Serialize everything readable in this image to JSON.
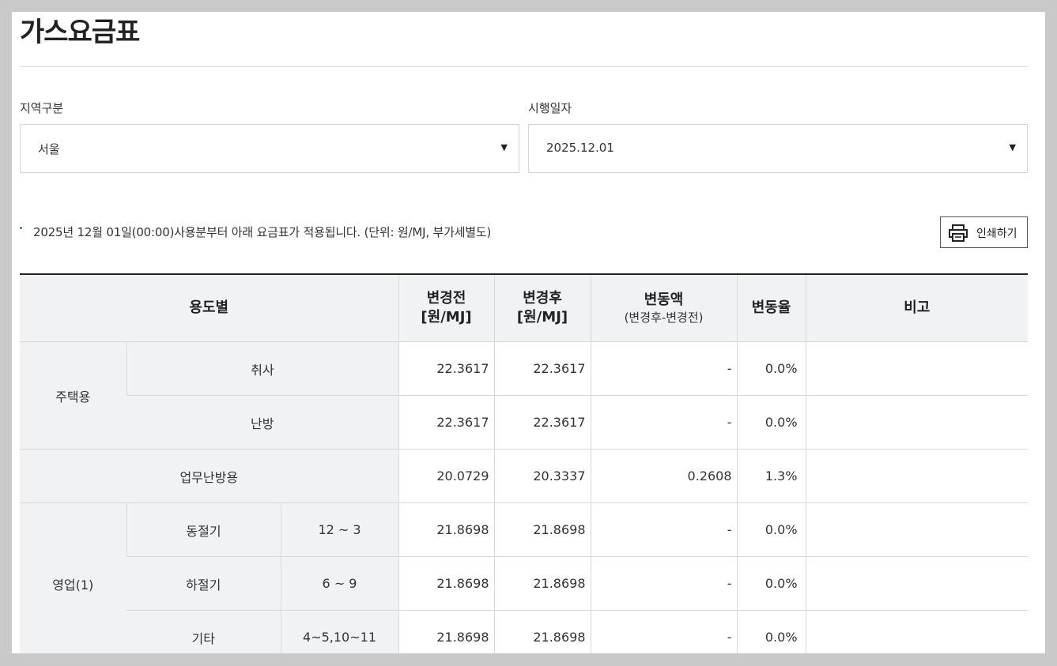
{
  "page": {
    "title": "가스요금표"
  },
  "filters": {
    "region_label": "지역구분",
    "region_value": "서울",
    "date_label": "시행일자",
    "date_value": "2025.12.01"
  },
  "notice": "2025년 12월 01일(00:00)사용분부터 아래 요금표가 적용됩니다. (단위: 원/MJ, 부가세별도)",
  "print_button": {
    "label": "인쇄하기",
    "icon": "printer-icon"
  },
  "table": {
    "headers": {
      "usage": "용도별",
      "before": "변경전",
      "before_unit": "[원/MJ]",
      "after": "변경후",
      "after_unit": "[원/MJ]",
      "diff": "변동액",
      "diff_sub": "(변경후-변경전)",
      "ratio": "변동율",
      "note": "비고"
    },
    "residential": {
      "group": "주택용",
      "rows": [
        {
          "type": "취사",
          "before": "22.3617",
          "after": "22.3617",
          "diff": "-",
          "ratio": "0.0%",
          "note": ""
        },
        {
          "type": "난방",
          "before": "22.3617",
          "after": "22.3617",
          "diff": "-",
          "ratio": "0.0%",
          "note": ""
        }
      ]
    },
    "office_heating": {
      "type": "업무난방용",
      "before": "20.0729",
      "after": "20.3337",
      "diff": "0.2608",
      "ratio": "1.3%",
      "note": ""
    },
    "business1": {
      "group": "영업(1)",
      "rows": [
        {
          "season": "동절기",
          "months": "12 ~ 3",
          "before": "21.8698",
          "after": "21.8698",
          "diff": "-",
          "ratio": "0.0%",
          "note": ""
        },
        {
          "season": "하절기",
          "months": "6 ~ 9",
          "before": "21.8698",
          "after": "21.8698",
          "diff": "-",
          "ratio": "0.0%",
          "note": ""
        },
        {
          "season": "기타",
          "months": "4~5,10~11",
          "before": "21.8698",
          "after": "21.8698",
          "diff": "-",
          "ratio": "0.0%",
          "note": ""
        }
      ]
    }
  },
  "colors": {
    "header_bg": "#f1f2f4",
    "border": "#d8d8d8",
    "bullet": "#3a6ad0"
  }
}
